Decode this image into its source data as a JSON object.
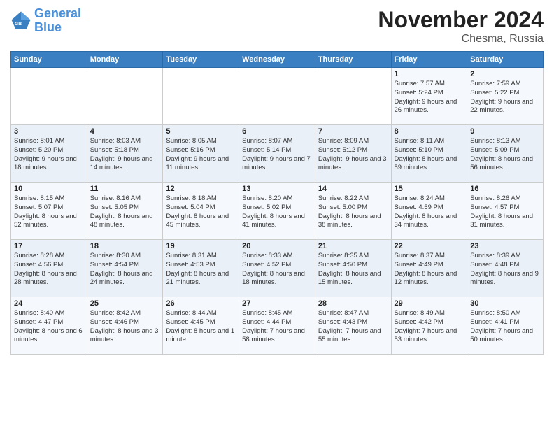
{
  "logo": {
    "line1": "General",
    "line2": "Blue"
  },
  "title": "November 2024",
  "location": "Chesma, Russia",
  "days_header": [
    "Sunday",
    "Monday",
    "Tuesday",
    "Wednesday",
    "Thursday",
    "Friday",
    "Saturday"
  ],
  "weeks": [
    [
      {
        "day": "",
        "info": ""
      },
      {
        "day": "",
        "info": ""
      },
      {
        "day": "",
        "info": ""
      },
      {
        "day": "",
        "info": ""
      },
      {
        "day": "",
        "info": ""
      },
      {
        "day": "1",
        "info": "Sunrise: 7:57 AM\nSunset: 5:24 PM\nDaylight: 9 hours\nand 26 minutes."
      },
      {
        "day": "2",
        "info": "Sunrise: 7:59 AM\nSunset: 5:22 PM\nDaylight: 9 hours\nand 22 minutes."
      }
    ],
    [
      {
        "day": "3",
        "info": "Sunrise: 8:01 AM\nSunset: 5:20 PM\nDaylight: 9 hours\nand 18 minutes."
      },
      {
        "day": "4",
        "info": "Sunrise: 8:03 AM\nSunset: 5:18 PM\nDaylight: 9 hours\nand 14 minutes."
      },
      {
        "day": "5",
        "info": "Sunrise: 8:05 AM\nSunset: 5:16 PM\nDaylight: 9 hours\nand 11 minutes."
      },
      {
        "day": "6",
        "info": "Sunrise: 8:07 AM\nSunset: 5:14 PM\nDaylight: 9 hours\nand 7 minutes."
      },
      {
        "day": "7",
        "info": "Sunrise: 8:09 AM\nSunset: 5:12 PM\nDaylight: 9 hours\nand 3 minutes."
      },
      {
        "day": "8",
        "info": "Sunrise: 8:11 AM\nSunset: 5:10 PM\nDaylight: 8 hours\nand 59 minutes."
      },
      {
        "day": "9",
        "info": "Sunrise: 8:13 AM\nSunset: 5:09 PM\nDaylight: 8 hours\nand 56 minutes."
      }
    ],
    [
      {
        "day": "10",
        "info": "Sunrise: 8:15 AM\nSunset: 5:07 PM\nDaylight: 8 hours\nand 52 minutes."
      },
      {
        "day": "11",
        "info": "Sunrise: 8:16 AM\nSunset: 5:05 PM\nDaylight: 8 hours\nand 48 minutes."
      },
      {
        "day": "12",
        "info": "Sunrise: 8:18 AM\nSunset: 5:04 PM\nDaylight: 8 hours\nand 45 minutes."
      },
      {
        "day": "13",
        "info": "Sunrise: 8:20 AM\nSunset: 5:02 PM\nDaylight: 8 hours\nand 41 minutes."
      },
      {
        "day": "14",
        "info": "Sunrise: 8:22 AM\nSunset: 5:00 PM\nDaylight: 8 hours\nand 38 minutes."
      },
      {
        "day": "15",
        "info": "Sunrise: 8:24 AM\nSunset: 4:59 PM\nDaylight: 8 hours\nand 34 minutes."
      },
      {
        "day": "16",
        "info": "Sunrise: 8:26 AM\nSunset: 4:57 PM\nDaylight: 8 hours\nand 31 minutes."
      }
    ],
    [
      {
        "day": "17",
        "info": "Sunrise: 8:28 AM\nSunset: 4:56 PM\nDaylight: 8 hours\nand 28 minutes."
      },
      {
        "day": "18",
        "info": "Sunrise: 8:30 AM\nSunset: 4:54 PM\nDaylight: 8 hours\nand 24 minutes."
      },
      {
        "day": "19",
        "info": "Sunrise: 8:31 AM\nSunset: 4:53 PM\nDaylight: 8 hours\nand 21 minutes."
      },
      {
        "day": "20",
        "info": "Sunrise: 8:33 AM\nSunset: 4:52 PM\nDaylight: 8 hours\nand 18 minutes."
      },
      {
        "day": "21",
        "info": "Sunrise: 8:35 AM\nSunset: 4:50 PM\nDaylight: 8 hours\nand 15 minutes."
      },
      {
        "day": "22",
        "info": "Sunrise: 8:37 AM\nSunset: 4:49 PM\nDaylight: 8 hours\nand 12 minutes."
      },
      {
        "day": "23",
        "info": "Sunrise: 8:39 AM\nSunset: 4:48 PM\nDaylight: 8 hours\nand 9 minutes."
      }
    ],
    [
      {
        "day": "24",
        "info": "Sunrise: 8:40 AM\nSunset: 4:47 PM\nDaylight: 8 hours\nand 6 minutes."
      },
      {
        "day": "25",
        "info": "Sunrise: 8:42 AM\nSunset: 4:46 PM\nDaylight: 8 hours\nand 3 minutes."
      },
      {
        "day": "26",
        "info": "Sunrise: 8:44 AM\nSunset: 4:45 PM\nDaylight: 8 hours\nand 1 minute."
      },
      {
        "day": "27",
        "info": "Sunrise: 8:45 AM\nSunset: 4:44 PM\nDaylight: 7 hours\nand 58 minutes."
      },
      {
        "day": "28",
        "info": "Sunrise: 8:47 AM\nSunset: 4:43 PM\nDaylight: 7 hours\nand 55 minutes."
      },
      {
        "day": "29",
        "info": "Sunrise: 8:49 AM\nSunset: 4:42 PM\nDaylight: 7 hours\nand 53 minutes."
      },
      {
        "day": "30",
        "info": "Sunrise: 8:50 AM\nSunset: 4:41 PM\nDaylight: 7 hours\nand 50 minutes."
      }
    ]
  ]
}
